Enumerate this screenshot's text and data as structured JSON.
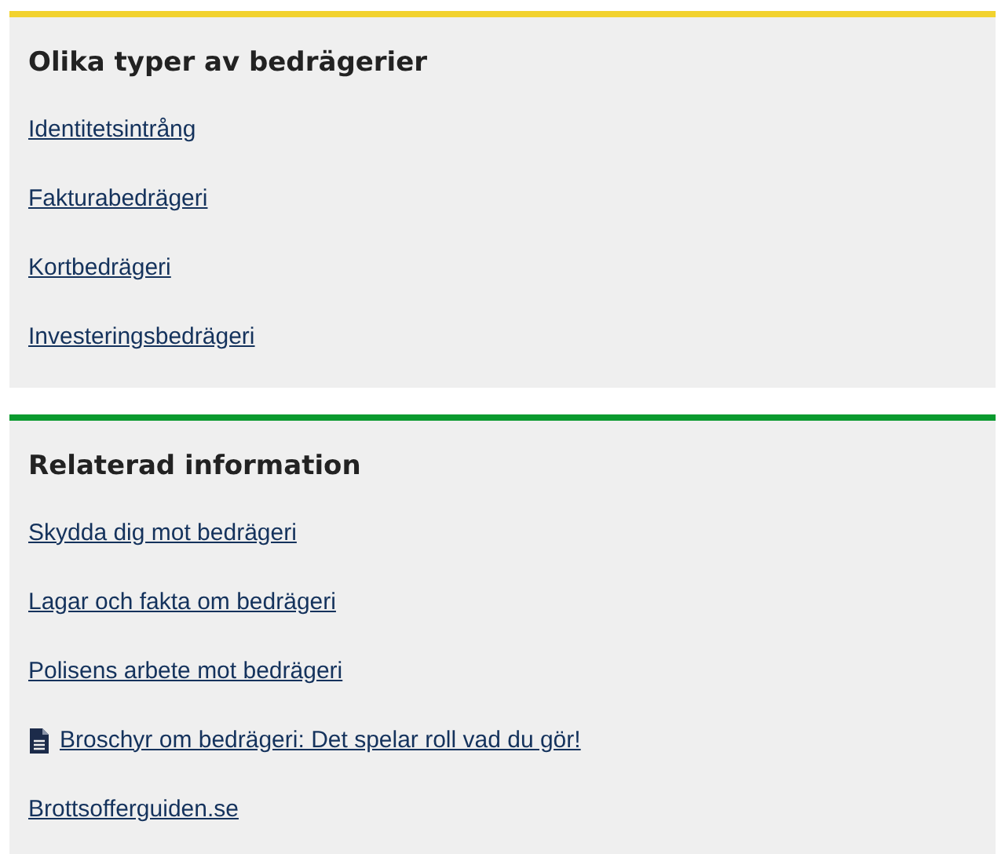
{
  "panels": [
    {
      "heading": "Olika typer av bedrägerier",
      "color": "#f2d22e",
      "links": [
        {
          "kind": "link",
          "label": "Identitetsintrång"
        },
        {
          "kind": "link",
          "label": "Fakturabedrägeri"
        },
        {
          "kind": "link",
          "label": "Kortbedrägeri"
        },
        {
          "kind": "link",
          "label": "Investeringsbedrägeri"
        }
      ]
    },
    {
      "heading": "Relaterad information",
      "color": "#0a9a2e",
      "links": [
        {
          "kind": "link",
          "label": "Skydda dig mot bedrägeri"
        },
        {
          "kind": "link",
          "label": "Lagar och fakta om bedrägeri"
        },
        {
          "kind": "link",
          "label": "Polisens arbete mot bedrägeri"
        },
        {
          "kind": "document",
          "label": "Broschyr om bedrägeri: Det spelar roll vad du gör!"
        },
        {
          "kind": "link",
          "label": "Brottsofferguiden.se"
        }
      ]
    }
  ]
}
